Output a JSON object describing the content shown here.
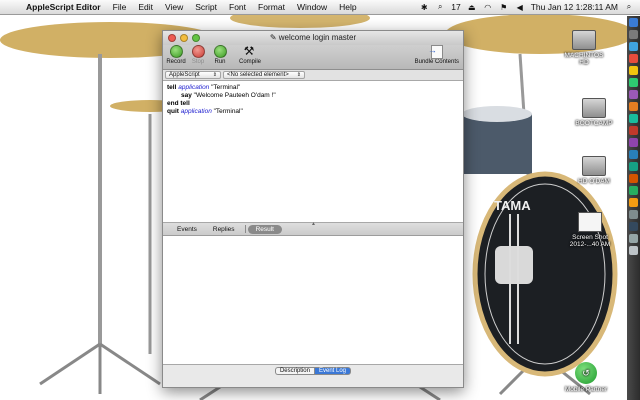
{
  "menubar": {
    "app_name": "AppleScript Editor",
    "items": [
      "File",
      "Edit",
      "View",
      "Script",
      "Font",
      "Format",
      "Window",
      "Help"
    ],
    "status": {
      "badge_count": "17",
      "datetime": "Thu Jan 12  1:28:11 AM"
    }
  },
  "window": {
    "title": "welcome login master",
    "toolbar": {
      "record": "Record",
      "stop": "Stop",
      "run": "Run",
      "compile": "Compile",
      "bundle": "Bundle Contents"
    },
    "navbar": {
      "language": "AppleScript",
      "element": "<No selected element>"
    },
    "code": {
      "l1_kw": "tell",
      "l1_app": "application",
      "l1_str": "\"Terminal\"",
      "l2_kw": "say",
      "l2_str": "\"Welcome Pauteeh O'dam !\"",
      "l3_kw": "end tell",
      "l4_kw": "quit",
      "l4_app": "application",
      "l4_str": "\"Terminal\""
    },
    "tabs": {
      "events": "Events",
      "replies": "Replies",
      "result": "Result"
    },
    "bottom": {
      "description": "Description",
      "event_log": "Event Log"
    }
  },
  "desktop": {
    "icons": [
      {
        "label": "MACHINTOS HD"
      },
      {
        "label": "BOOTCAMP"
      },
      {
        "label": "HD O'DAM"
      },
      {
        "label": "Screen Shot 2012-...40 AM"
      },
      {
        "label": "Mobile Partner"
      }
    ]
  },
  "drum_brand": "TAMA",
  "colors": {
    "run_green": "#3a9a22",
    "stop_red": "#c93b33",
    "keyword_blue": "#2020d0",
    "selected_segment": "#3b78d6"
  }
}
